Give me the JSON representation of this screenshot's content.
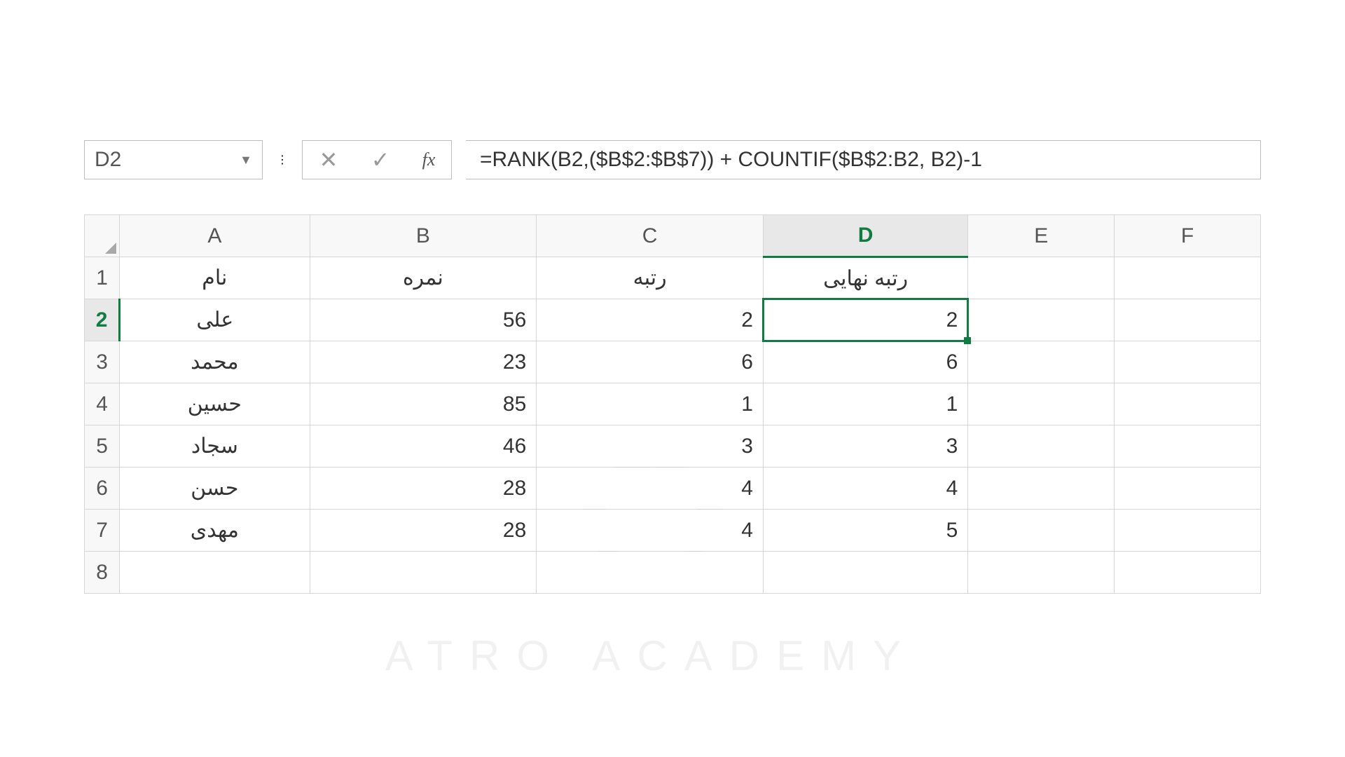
{
  "name_box": "D2",
  "formula": "=RANK(B2,($B$2:$B$7)) + COUNTIF($B$2:B2, B2)-1",
  "fx_label": "fx",
  "columns": [
    "A",
    "B",
    "C",
    "D",
    "E",
    "F"
  ],
  "selected_col": "D",
  "selected_row": "2",
  "row_numbers": [
    "1",
    "2",
    "3",
    "4",
    "5",
    "6",
    "7",
    "8"
  ],
  "headers": {
    "A": "نام",
    "B": "نمره",
    "C": "رتبه",
    "D": "رتبه نهایی"
  },
  "rows": [
    {
      "A": "علی",
      "B": "56",
      "C": "2",
      "D": "2"
    },
    {
      "A": "محمد",
      "B": "23",
      "C": "6",
      "D": "6"
    },
    {
      "A": "حسین",
      "B": "85",
      "C": "1",
      "D": "1"
    },
    {
      "A": "سجاد",
      "B": "46",
      "C": "3",
      "D": "3"
    },
    {
      "A": "حسن",
      "B": "28",
      "C": "4",
      "D": "4"
    },
    {
      "A": "مهدی",
      "B": "28",
      "C": "4",
      "D": "5"
    }
  ],
  "watermark_text": "ATRO ACADEMY"
}
